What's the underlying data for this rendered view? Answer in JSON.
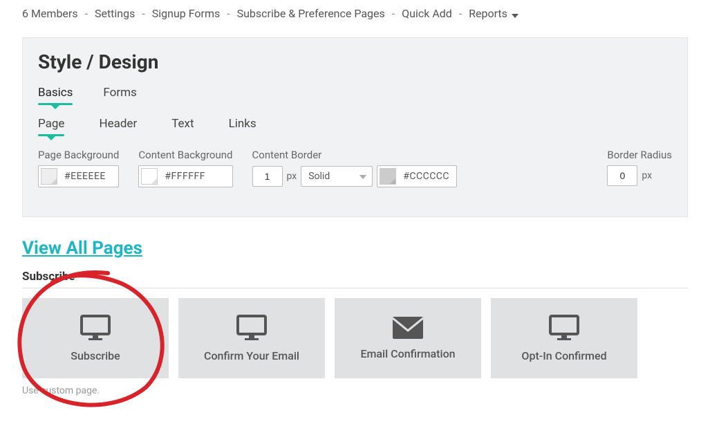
{
  "breadcrumb": {
    "members": "6 Members",
    "settings": "Settings",
    "signup_forms": "Signup Forms",
    "sub_pref": "Subscribe & Preference Pages",
    "quick_add": "Quick Add",
    "reports": "Reports"
  },
  "panel": {
    "title": "Style / Design",
    "tabs": {
      "basics": "Basics",
      "forms": "Forms"
    },
    "subtabs": {
      "page": "Page",
      "header": "Header",
      "text": "Text",
      "links": "Links"
    },
    "controls": {
      "page_bg": {
        "label": "Page Background",
        "value": "#EEEEEE"
      },
      "content_bg": {
        "label": "Content Background",
        "value": "#FFFFFF"
      },
      "content_border": {
        "label": "Content Border",
        "width": "1",
        "unit": "px",
        "style": "Solid",
        "color": "#CCCCCC"
      },
      "border_radius": {
        "label": "Border Radius",
        "value": "0",
        "unit": "px"
      }
    }
  },
  "view_all": "View All Pages",
  "section": {
    "title": "Subscribe"
  },
  "cards": {
    "subscribe": "Subscribe",
    "confirm_email": "Confirm Your Email",
    "email_confirmation": "Email Confirmation",
    "optin_confirmed": "Opt-In Confirmed"
  },
  "use_custom": "Use custom page."
}
